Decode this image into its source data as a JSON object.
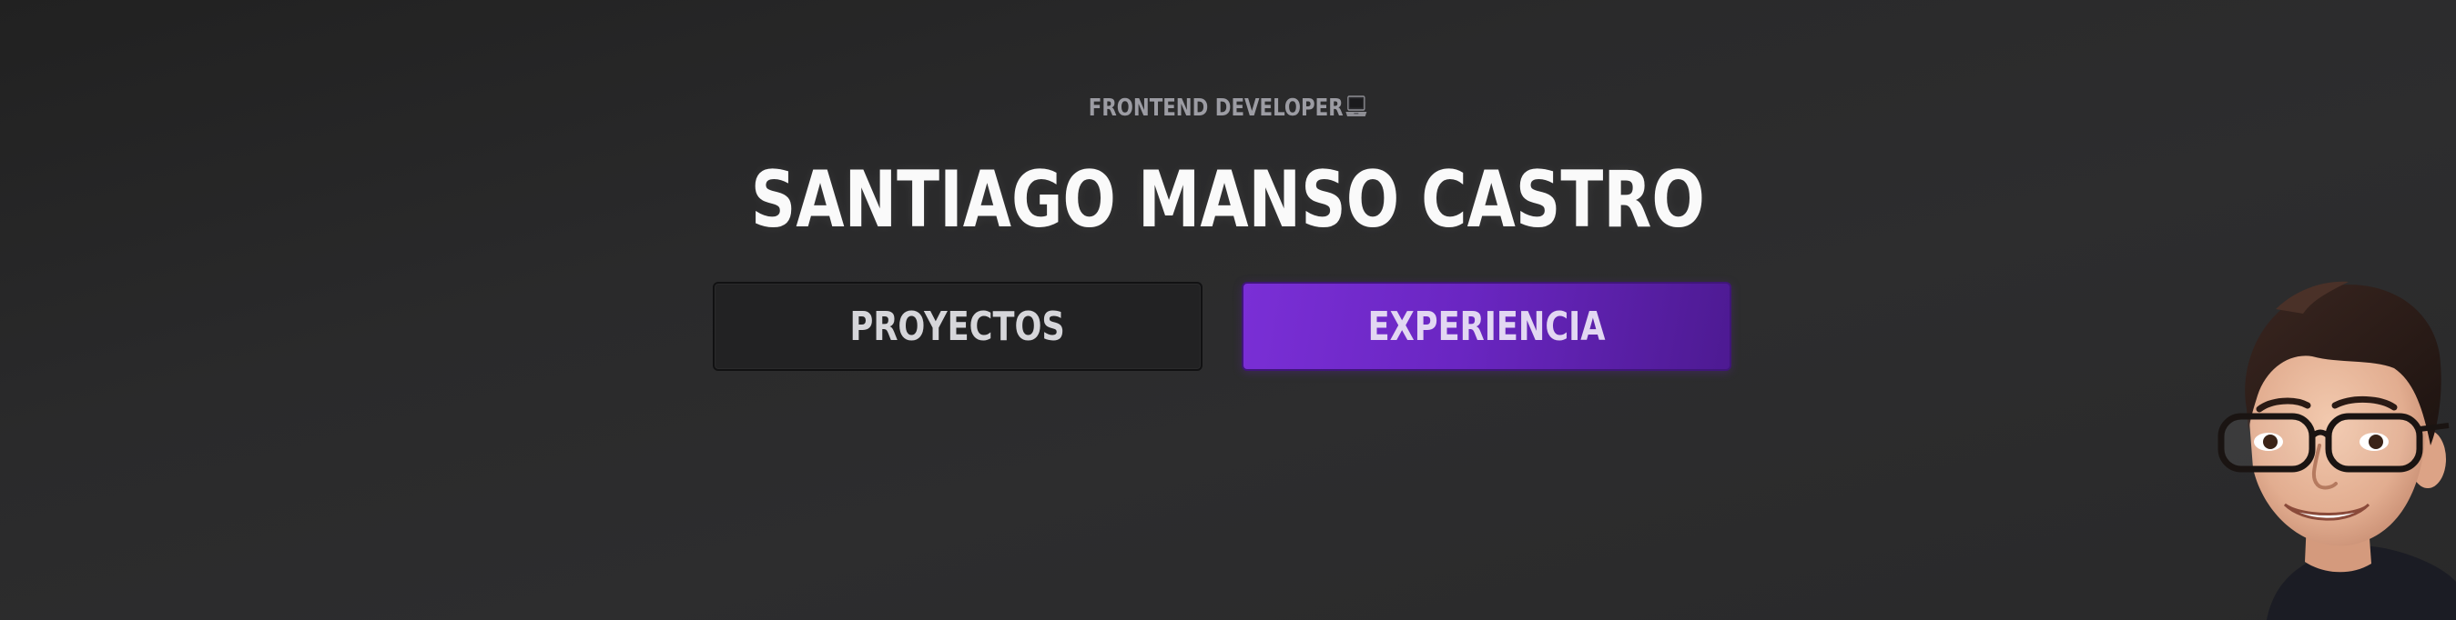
{
  "hero": {
    "subtitle": "FRONTEND DEVELOPER",
    "subtitle_icon": "laptop-icon",
    "name": "SANTIAGO MANSO CASTRO"
  },
  "actions": {
    "projects_label": "PROYECTOS",
    "experience_label": "EXPERIENCIA"
  },
  "colors": {
    "accent": "#7a2fd6",
    "background": "#2a2a2b",
    "secondary_button": "#222223"
  }
}
